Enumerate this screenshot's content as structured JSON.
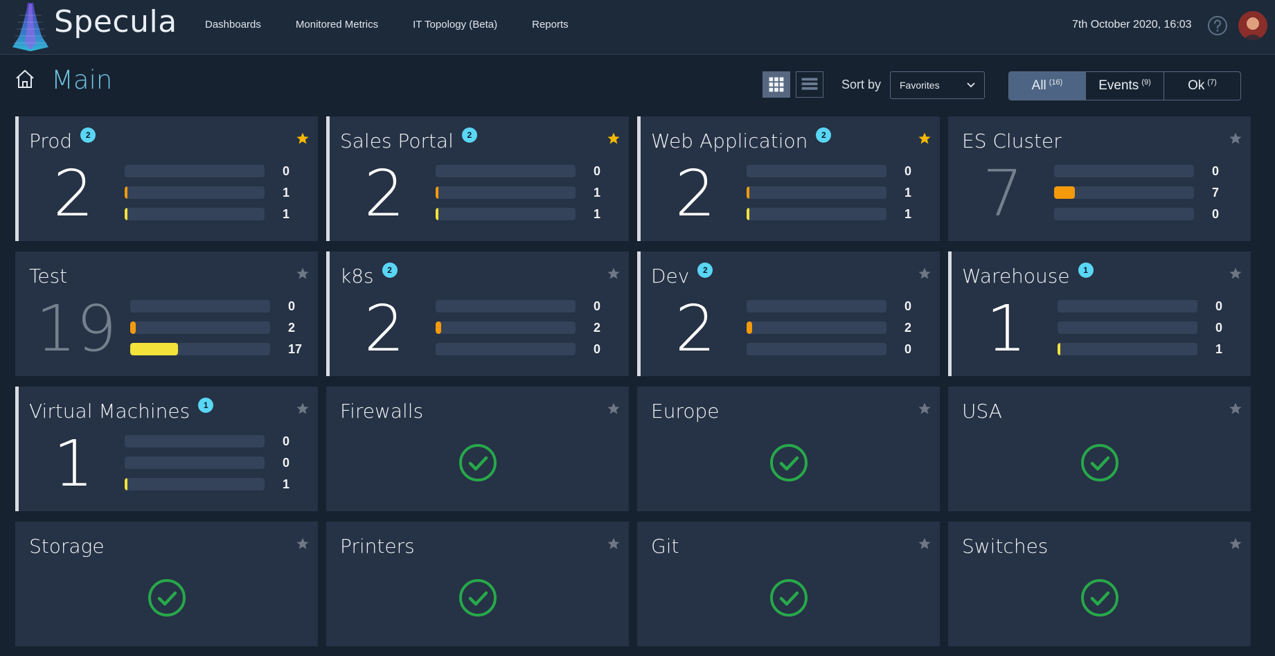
{
  "app": {
    "brand": "Specula",
    "nav": [
      "Dashboards",
      "Monitored Metrics",
      "IT Topology (Beta)",
      "Reports"
    ],
    "datetime": "7th October 2020, 16:03"
  },
  "header": {
    "title": "Main",
    "sort_label": "Sort by",
    "sort_value": "Favorites",
    "filters": [
      {
        "label": "All",
        "count": "(16)",
        "active": true
      },
      {
        "label": "Events",
        "count": "(9)",
        "active": false
      },
      {
        "label": "Ok",
        "count": "(7)",
        "active": false
      }
    ]
  },
  "colors": {
    "accent": "#6fc3e0",
    "badge": "#5ad6f5",
    "star_favorite": "#f5b800",
    "star_default": "#6d7785",
    "bar_orange": "#f59a0c",
    "bar_yellow": "#f3e23a",
    "ok_green": "#27a84a"
  },
  "cards": [
    {
      "title": "Prod",
      "badge": "2",
      "favorite": true,
      "total": "2",
      "dim": false,
      "values": [
        "0",
        "1",
        "1"
      ],
      "fills": [
        0,
        0.02,
        0.02
      ]
    },
    {
      "title": "Sales Portal",
      "badge": "2",
      "favorite": true,
      "total": "2",
      "dim": false,
      "values": [
        "0",
        "1",
        "1"
      ],
      "fills": [
        0,
        0.02,
        0.02
      ]
    },
    {
      "title": "Web Application",
      "badge": "2",
      "favorite": true,
      "total": "2",
      "dim": false,
      "values": [
        "0",
        "1",
        "1"
      ],
      "fills": [
        0,
        0.02,
        0.02
      ]
    },
    {
      "title": "ES Cluster",
      "badge": "",
      "favorite": false,
      "total": "7",
      "dim": true,
      "values": [
        "0",
        "7",
        "0"
      ],
      "fills": [
        0,
        0.15,
        0
      ]
    },
    {
      "title": "Test",
      "badge": "",
      "favorite": false,
      "total": "19",
      "dim": true,
      "values": [
        "0",
        "2",
        "17"
      ],
      "fills": [
        0,
        0.04,
        0.34
      ]
    },
    {
      "title": "k8s",
      "badge": "2",
      "favorite": false,
      "total": "2",
      "dim": false,
      "values": [
        "0",
        "2",
        "0"
      ],
      "fills": [
        0,
        0.04,
        0
      ]
    },
    {
      "title": "Dev",
      "badge": "2",
      "favorite": false,
      "total": "2",
      "dim": false,
      "values": [
        "0",
        "2",
        "0"
      ],
      "fills": [
        0,
        0.04,
        0
      ]
    },
    {
      "title": "Warehouse",
      "badge": "1",
      "favorite": false,
      "total": "1",
      "dim": false,
      "values": [
        "0",
        "0",
        "1"
      ],
      "fills": [
        0,
        0,
        0.02
      ]
    },
    {
      "title": "Virtual Machines",
      "badge": "1",
      "favorite": false,
      "total": "1",
      "dim": false,
      "values": [
        "0",
        "0",
        "1"
      ],
      "fills": [
        0,
        0,
        0.02
      ]
    },
    {
      "title": "Firewalls",
      "ok": true
    },
    {
      "title": "Europe",
      "ok": true
    },
    {
      "title": "USA",
      "ok": true
    },
    {
      "title": "Storage",
      "ok": true
    },
    {
      "title": "Printers",
      "ok": true
    },
    {
      "title": "Git",
      "ok": true
    },
    {
      "title": "Switches",
      "ok": true
    }
  ]
}
